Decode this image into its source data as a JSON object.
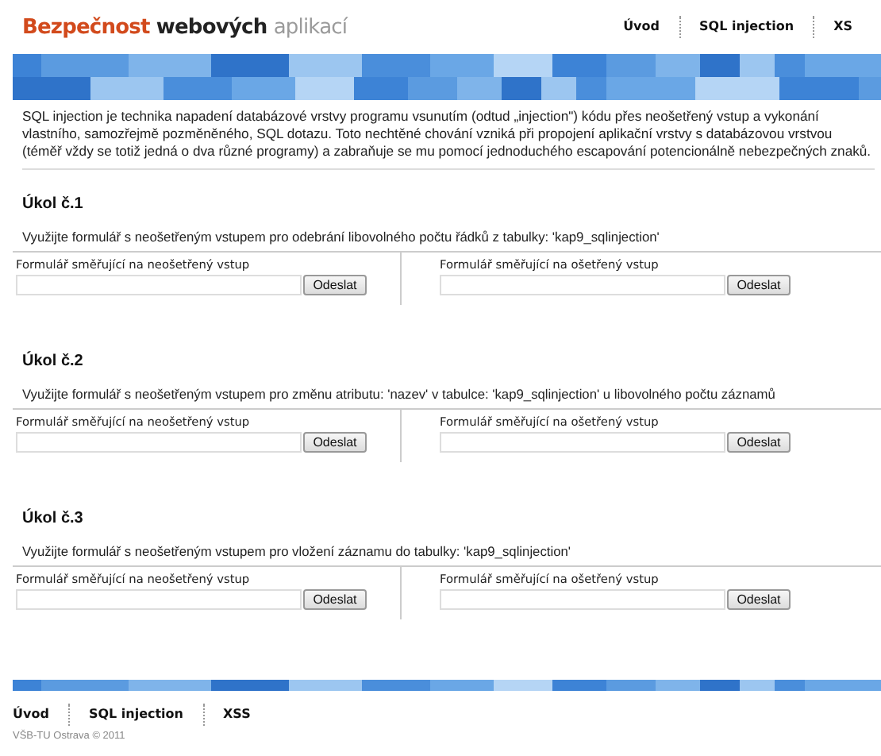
{
  "header": {
    "title": {
      "part_1": "Bezpečnost",
      "part_2": "webových",
      "part_3": "aplikací"
    },
    "nav": [
      "Úvod",
      "SQL injection",
      "XS"
    ]
  },
  "intro": "SQL injection je technika napadení databázové vrstvy programu vsunutím (odtud „injection\") kódu přes neošetřený vstup a vykonání vlastního, samozřejmě pozměněného, SQL dotazu. Toto nechtěné chování vzniká při propojení aplikační vrstvy s databázovou vrstvou (téměř vždy se totiž jedná o dva různé programy) a zabraňuje se mu pomocí jednoduchého escapování potencionálně nebezpečných znaků.",
  "tasks": [
    {
      "heading": "Úkol č.1",
      "description": "Využijte formulář s neošetřeným vstupem pro odebrání libovolného počtu řádků z tabulky: 'kap9_sqlinjection'",
      "forms": [
        {
          "label": "Formulář směřující na neošetřený vstup",
          "button": "Odeslat"
        },
        {
          "label": "Formulář směřující na ošetřený vstup",
          "button": "Odeslat"
        }
      ]
    },
    {
      "heading": "Úkol č.2",
      "description": "Využijte formulář s neošetřeným vstupem pro změnu atributu: 'nazev' v tabulce: 'kap9_sqlinjection' u libovolného počtu záznamů",
      "forms": [
        {
          "label": "Formulář směřující na neošetřený vstup",
          "button": "Odeslat"
        },
        {
          "label": "Formulář směřující na ošetřený vstup",
          "button": "Odeslat"
        }
      ]
    },
    {
      "heading": "Úkol č.3",
      "description": "Využijte formulář s neošetřeným vstupem pro vložení záznamu do tabulky: 'kap9_sqlinjection'",
      "forms": [
        {
          "label": "Formulář směřující na neošetřený vstup",
          "button": "Odeslat"
        },
        {
          "label": "Formulář směřující na ošetřený vstup",
          "button": "Odeslat"
        }
      ]
    }
  ],
  "footer": {
    "nav": [
      "Úvod",
      "SQL injection",
      "XSS"
    ],
    "copyright": "VŠB-TU Ostrava © 2011"
  }
}
